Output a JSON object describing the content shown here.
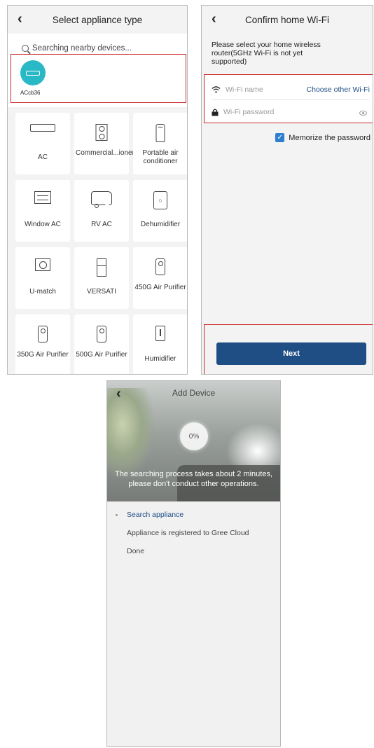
{
  "screen1": {
    "title": "Select appliance type",
    "searching": "Searching nearby devices...",
    "found_device": {
      "name": "ACcb36",
      "color": "#29b9c6"
    },
    "appliances": [
      {
        "label": "AC",
        "icon": "ac-unit-icon"
      },
      {
        "label": "Commercial...ioner",
        "icon": "commercial-ac-icon"
      },
      {
        "label": "Portable air conditioner",
        "icon": "portable-ac-icon"
      },
      {
        "label": "Window AC",
        "icon": "window-ac-icon"
      },
      {
        "label": "RV AC",
        "icon": "rv-icon"
      },
      {
        "label": "Dehumidifier",
        "icon": "dehumidifier-icon"
      },
      {
        "label": "U-match",
        "icon": "u-match-icon"
      },
      {
        "label": "VERSATI",
        "icon": "versati-icon"
      },
      {
        "label": "450G Air Purifier",
        "icon": "air-purifier-icon"
      },
      {
        "label": "350G Air Purifier",
        "icon": "air-purifier-icon"
      },
      {
        "label": "500G Air Purifier",
        "icon": "air-purifier-icon"
      },
      {
        "label": "Humidifier",
        "icon": "humidifier-icon"
      }
    ]
  },
  "screen2": {
    "title": "Confirm home Wi-Fi",
    "instructions": "Please select your home wireless router(5GHz Wi-Fi is not yet supported)",
    "wifi_name_placeholder": "Wi-Fi name",
    "choose_other": "Choose other Wi-Fi",
    "wifi_password_placeholder": "Wi-Fi password",
    "memorize": "Memorize the password",
    "memorize_checked": true,
    "next": "Next",
    "accent": "#1f4e85"
  },
  "screen3": {
    "title": "Add Device",
    "progress": "0%",
    "message": "The searching process takes about 2 minutes, please don't conduct other operations.",
    "steps": [
      {
        "label": "Search appliance",
        "active": true
      },
      {
        "label": "Appliance is registered to Gree Cloud",
        "active": false
      },
      {
        "label": "Done",
        "active": false
      }
    ]
  }
}
